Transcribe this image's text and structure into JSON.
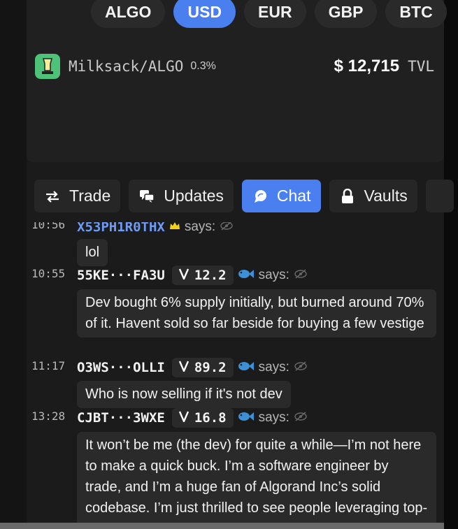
{
  "currencies": [
    {
      "label": "ALGO",
      "active": false
    },
    {
      "label": "USD",
      "active": true
    },
    {
      "label": "EUR",
      "active": false
    },
    {
      "label": "GBP",
      "active": false
    },
    {
      "label": "BTC",
      "active": false
    }
  ],
  "pool": {
    "name": "Milksack/ALGO",
    "fee": "0.3%",
    "tvl_value": "$ 12,715",
    "tvl_label": "TVL"
  },
  "tabs": [
    {
      "label": "Trade",
      "icon": "swap-arrows-icon",
      "active": false
    },
    {
      "label": "Updates",
      "icon": "comments-icon",
      "active": false
    },
    {
      "label": "Chat",
      "icon": "chat-bubble-icon",
      "active": true
    },
    {
      "label": "Vaults",
      "icon": "lock-icon",
      "active": false
    }
  ],
  "messages": [
    {
      "time": "10:56",
      "user": "X53PH1R0THX",
      "badge": "crown-icon",
      "says": "says:",
      "text": "lol"
    },
    {
      "time": "10:55",
      "user": "55KE···FA3U",
      "score": "12.2",
      "says": "says:",
      "text": "Dev bought 6% supply initially, but burned around 70% of it. Havent sold so far beside for buying a few vestige"
    },
    {
      "time": "11:17",
      "user": "O3WS···OLLI",
      "score": "89.2",
      "says": "says:",
      "text": "Who is now selling if it's not dev"
    },
    {
      "time": "13:28",
      "user": "CJBT···3WXE",
      "score": "16.8",
      "says": "says:",
      "text": "It won’t be me (the dev) for quite a while—I’m not here to make a quick buck. I’m a software engineer by trade, and I’m a huge fan of Algorand Inc’s solid codebase. I’m just thrilled to see people leveraging top-notch tech, even if it’"
    }
  ],
  "colors": {
    "accent": "#4a7ff0",
    "fish": "#3d8fd6",
    "crown": "#f2d21b",
    "logo_bg": "#4fc27a"
  }
}
